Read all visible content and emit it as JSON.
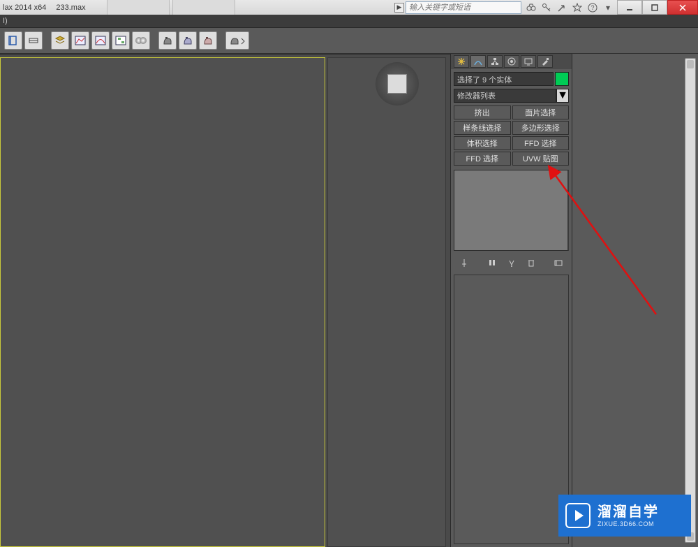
{
  "title": {
    "app": "lax  2014 x64",
    "file": "233.max"
  },
  "search": {
    "placeholder": "输入关键字或短语"
  },
  "menubar": {
    "letter": "I)"
  },
  "toolbar": {
    "icons": [
      "named-selection-icon",
      "separator",
      "attach-icon",
      "quick-align-icon",
      "align-icon",
      "snapshot-icon",
      "mirror-icon",
      "separator",
      "array-icon",
      "separator",
      "teapot-a-icon",
      "teapot-b-icon",
      "teapot-c-icon",
      "separator",
      "material-editor-icon"
    ]
  },
  "command_panel": {
    "tabs": [
      "create-tab-icon",
      "modify-tab-icon",
      "hierarchy-tab-icon",
      "motion-tab-icon",
      "display-tab-icon",
      "utilities-tab-icon"
    ],
    "selection_text": "选择了 9 个实体",
    "modifier_list_label": "修改器列表",
    "modifier_buttons": [
      [
        "挤出",
        "面片选择"
      ],
      [
        "样条线选择",
        "多边形选择"
      ],
      [
        "体积选择",
        "FFD 选择"
      ],
      [
        "FFD 选择",
        "UVW 贴图"
      ]
    ],
    "stack_tools": [
      "pin-icon",
      "stack-icon",
      "show-end-result-icon",
      "make-unique-icon",
      "remove-modifier-icon",
      "configure-icon"
    ]
  },
  "watermark": {
    "cn": "溜溜自学",
    "en": "ZIXUE.3D66.COM"
  }
}
